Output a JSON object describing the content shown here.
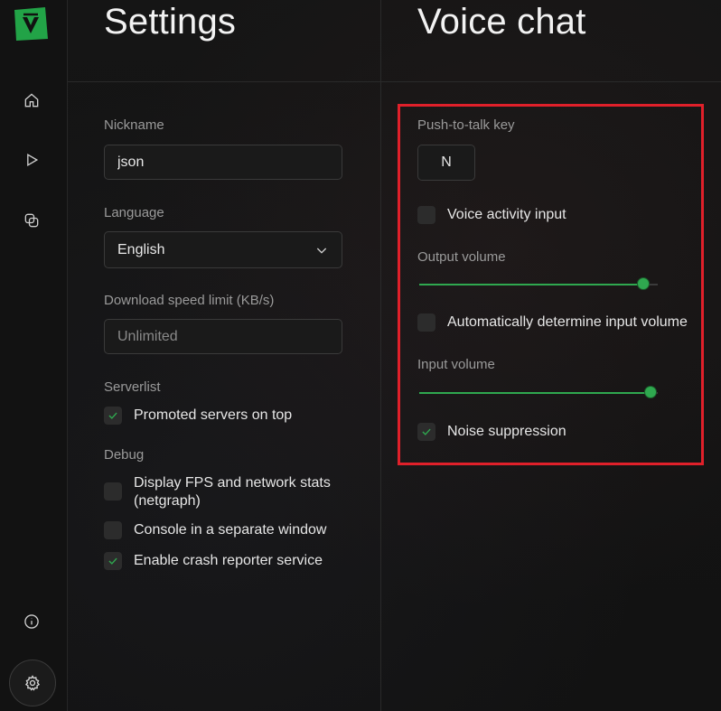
{
  "app": {
    "accent_color": "#2fa84f",
    "logo_icon": "v-logo-icon"
  },
  "sidebar": {
    "items": [
      {
        "name": "home",
        "icon": "home-icon"
      },
      {
        "name": "play",
        "icon": "play-icon"
      },
      {
        "name": "servers",
        "icon": "overlap-icon"
      }
    ],
    "bottom": [
      {
        "name": "info",
        "icon": "info-icon"
      },
      {
        "name": "settings",
        "icon": "gear-icon"
      }
    ]
  },
  "settings": {
    "title": "Settings",
    "nickname": {
      "label": "Nickname",
      "value": "json"
    },
    "language": {
      "label": "Language",
      "value": "English"
    },
    "download_limit": {
      "label": "Download speed limit (KB/s)",
      "placeholder": "Unlimited"
    },
    "serverlist": {
      "label": "Serverlist",
      "promoted_on_top": {
        "label": "Promoted servers on top",
        "checked": true
      }
    },
    "debug": {
      "label": "Debug",
      "fps_stats": {
        "label": "Display FPS and network stats (netgraph)",
        "checked": false
      },
      "console_window": {
        "label": "Console in a separate window",
        "checked": false
      },
      "crash_reporter": {
        "label": "Enable crash reporter service",
        "checked": true
      }
    }
  },
  "voice_chat": {
    "title": "Voice chat",
    "push_to_talk": {
      "label": "Push-to-talk key",
      "value": "N"
    },
    "voice_activity": {
      "label": "Voice activity input",
      "checked": false
    },
    "output_volume": {
      "label": "Output volume",
      "level": 0.94
    },
    "auto_input_volume": {
      "label": "Automatically determine input volume",
      "checked": false
    },
    "input_volume": {
      "label": "Input volume",
      "level": 0.97
    },
    "noise_suppression": {
      "label": "Noise suppression",
      "checked": true
    },
    "highlight_color": "#e0202a"
  }
}
